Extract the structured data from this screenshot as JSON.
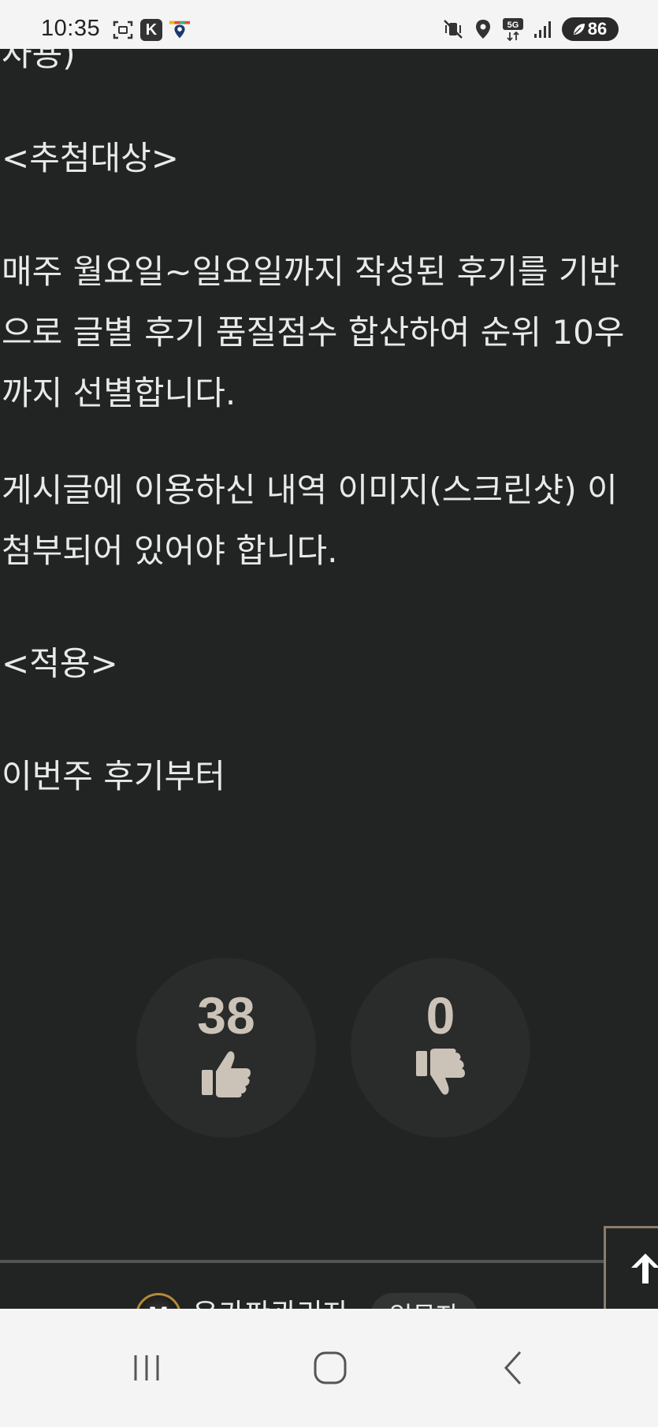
{
  "status_bar": {
    "time": "10:35",
    "battery": "86",
    "icons": [
      "screenshot-icon",
      "k-app-icon",
      "map-pin-app-icon",
      "mute-vibrate-icon",
      "location-icon",
      "5g-icon",
      "signal-icon",
      "battery-icon"
    ],
    "k_label": "K",
    "network_label": "5G"
  },
  "article": {
    "lines": [
      "사용)",
      "<추첨대상>",
      "매주 월요일~일요일까지 작성된 후기를 기반",
      "으로 글별 후기 품질점수 합산하여 순위 10우",
      "까지 선별합니다.",
      "게시글에 이용하신 내역 이미지(스크린샷) 이",
      "첨부되어 있어야 합니다.",
      "<적용>",
      "이번주 후기부터"
    ]
  },
  "votes": {
    "like_count": "38",
    "dislike_count": "0"
  },
  "author": {
    "avatar_letter": "M",
    "name": "온카판관리자",
    "rank": "입문자"
  },
  "colors": {
    "background": "#222424",
    "text": "#e9e9e9",
    "vote_accent": "#ccc3b8",
    "border_accent": "#8b7d6c"
  }
}
